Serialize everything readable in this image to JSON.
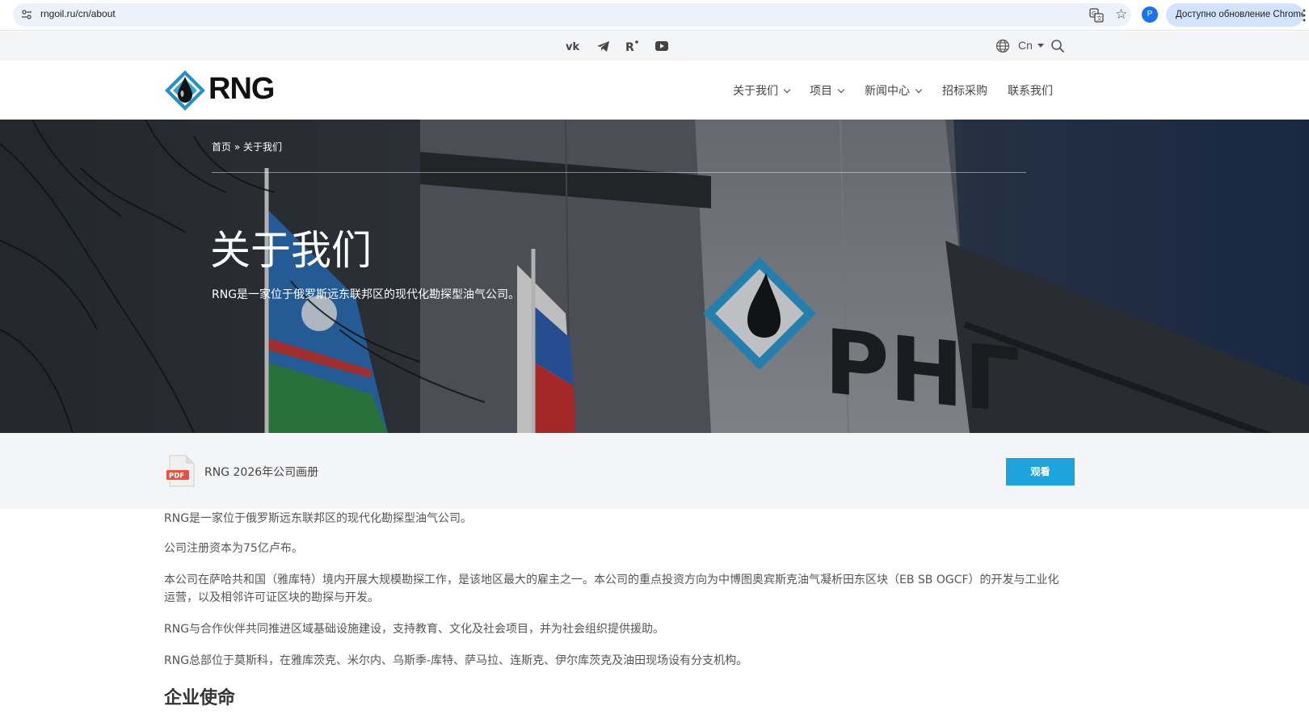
{
  "browser": {
    "url": "rngoil.ru/cn/about",
    "profile_initial": "P",
    "update_label": "Доступно обновление Chrome"
  },
  "topbar": {
    "social_icons": [
      "vk-icon",
      "telegram-icon",
      "rutube-icon",
      "youtube-icon"
    ],
    "lang_label": "Cn"
  },
  "header": {
    "logo_text": "RNG",
    "nav": [
      {
        "label": "关于我们",
        "has_dropdown": true
      },
      {
        "label": "项目",
        "has_dropdown": true
      },
      {
        "label": "新闻中心",
        "has_dropdown": true
      },
      {
        "label": "招标采购",
        "has_dropdown": false
      },
      {
        "label": "联系我们",
        "has_dropdown": false
      }
    ]
  },
  "hero": {
    "breadcrumb": "首页 » 关于我们",
    "title": "关于我们",
    "subtitle": "RNG是一家位于俄罗斯远东联邦区的现代化勘探型油气公司。",
    "building_sign": "РНГ"
  },
  "download": {
    "pdf_badge": "PDF",
    "label": "RNG 2026年公司画册",
    "button_label": "观看"
  },
  "content": {
    "paragraphs": [
      "RNG是一家位于俄罗斯远东联邦区的现代化勘探型油气公司。",
      "公司注册资本为75亿卢布。",
      "本公司在萨哈共和国（雅库特）境内开展大规模勘探工作，是该地区最大的雇主之一。本公司的重点投资方向为中博图奥宾斯克油气凝析田东区块（EB SB OGCF）的开发与工业化运营，以及相邻许可证区块的勘探与开发。",
      "RNG与合作伙伴共同推进区域基础设施建设，支持教育、文化及社会项目，并为社会组织提供援助。",
      "RNG总部位于莫斯科，在雅库茨克、米尔内、乌斯季-库特、萨马拉、连斯克、伊尔库茨克及油田现场设有分支机构。"
    ],
    "section_title": "企业使命"
  },
  "colors": {
    "accent": "#1ea4dc",
    "topbar_bg": "#f4f5f7",
    "pdf_red": "#e5533d"
  }
}
